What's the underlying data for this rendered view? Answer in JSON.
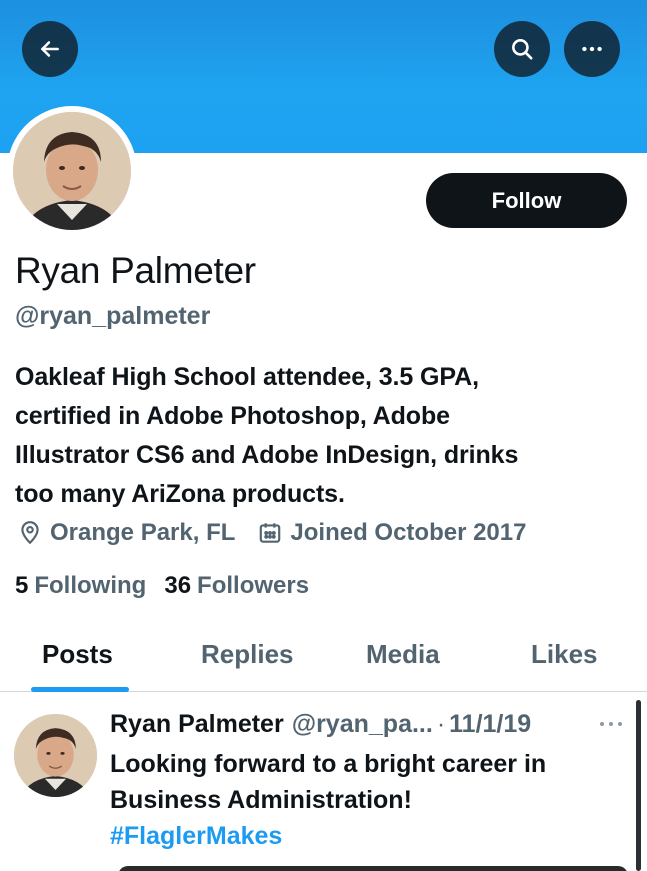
{
  "header": {
    "back_icon": "arrow-left-icon",
    "search_icon": "search-icon",
    "more_icon": "more-horizontal-icon"
  },
  "profile": {
    "name": "Ryan Palmeter",
    "handle": "@ryan_palmeter",
    "follow_label": "Follow",
    "bio_lines": [
      "Oakleaf High School attendee, 3.5 GPA,",
      "certified in Adobe Photoshop, Adobe",
      "Illustrator CS6 and Adobe InDesign, drinks",
      "too many AriZona products."
    ],
    "location": "Orange Park, FL",
    "joined": "Joined October 2017",
    "following_count": "5",
    "following_label": "Following",
    "followers_count": "36",
    "followers_label": "Followers"
  },
  "tabs": [
    {
      "label": "Posts",
      "active": true
    },
    {
      "label": "Replies",
      "active": false
    },
    {
      "label": "Media",
      "active": false
    },
    {
      "label": "Likes",
      "active": false
    }
  ],
  "post": {
    "name": "Ryan Palmeter",
    "handle": "@ryan_pa...",
    "separator": "·",
    "date": "11/1/19",
    "text_lines": [
      "Looking forward to a bright career in",
      "Business Administration!"
    ],
    "hashtag": "#FlaglerMakes"
  },
  "colors": {
    "banner": "#1da1f2",
    "accent": "#1d9bf0",
    "text_primary": "#0f1419",
    "text_secondary": "#536471",
    "button_dark": "#0f1419"
  }
}
